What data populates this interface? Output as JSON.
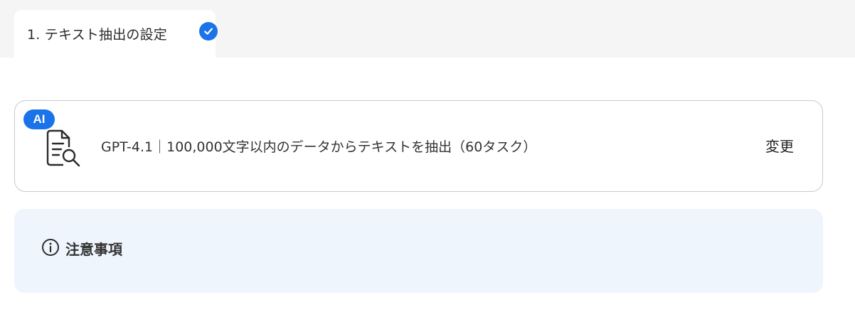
{
  "tab": {
    "label": "1. テキスト抽出の設定",
    "status_icon": "check-circle-icon",
    "accent_color": "#1a73e8"
  },
  "ai_card": {
    "badge": "AI",
    "icon": "document-search-icon",
    "description": "GPT-4.1｜100,000文字以内のデータからテキストを抽出（60タスク）",
    "change_label": "変更"
  },
  "notice": {
    "icon": "info-icon",
    "title": "注意事項",
    "background_color": "#eef5fd"
  }
}
